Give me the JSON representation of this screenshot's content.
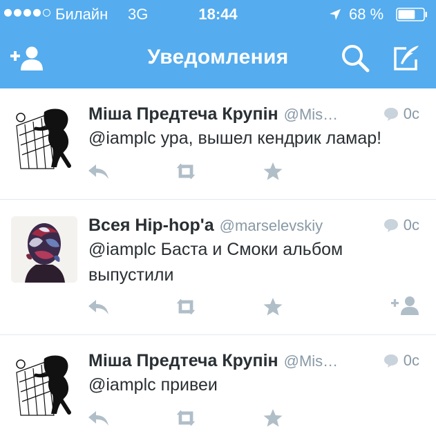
{
  "status": {
    "carrier": "Билайн",
    "network": "3G",
    "time": "18:44",
    "battery": "68 %",
    "battery_level": 0.68,
    "signal_bars_filled": 4,
    "signal_bars_total": 5
  },
  "nav": {
    "title": "Уведомления"
  },
  "tweets": [
    {
      "name": "Міша Предтеча Крупін",
      "handle": "@Mis…",
      "time": "0с",
      "text": "@iamplc ура, вышел кендрик ламар!"
    },
    {
      "name": "Всея Hip-hop'a",
      "handle": "@marselevskiy",
      "time": "0с",
      "text": "@iamplc Баста и Смоки альбом выпустили"
    },
    {
      "name": "Міша Предтеча Крупін",
      "handle": "@Mis…",
      "time": "0с",
      "text": "@iamplc привеи"
    }
  ],
  "colors": {
    "accent": "#55acee",
    "text": "#292f33",
    "secondary": "#8899a6",
    "action_icon": "#b0bec8",
    "divider": "#e1e8ed"
  }
}
